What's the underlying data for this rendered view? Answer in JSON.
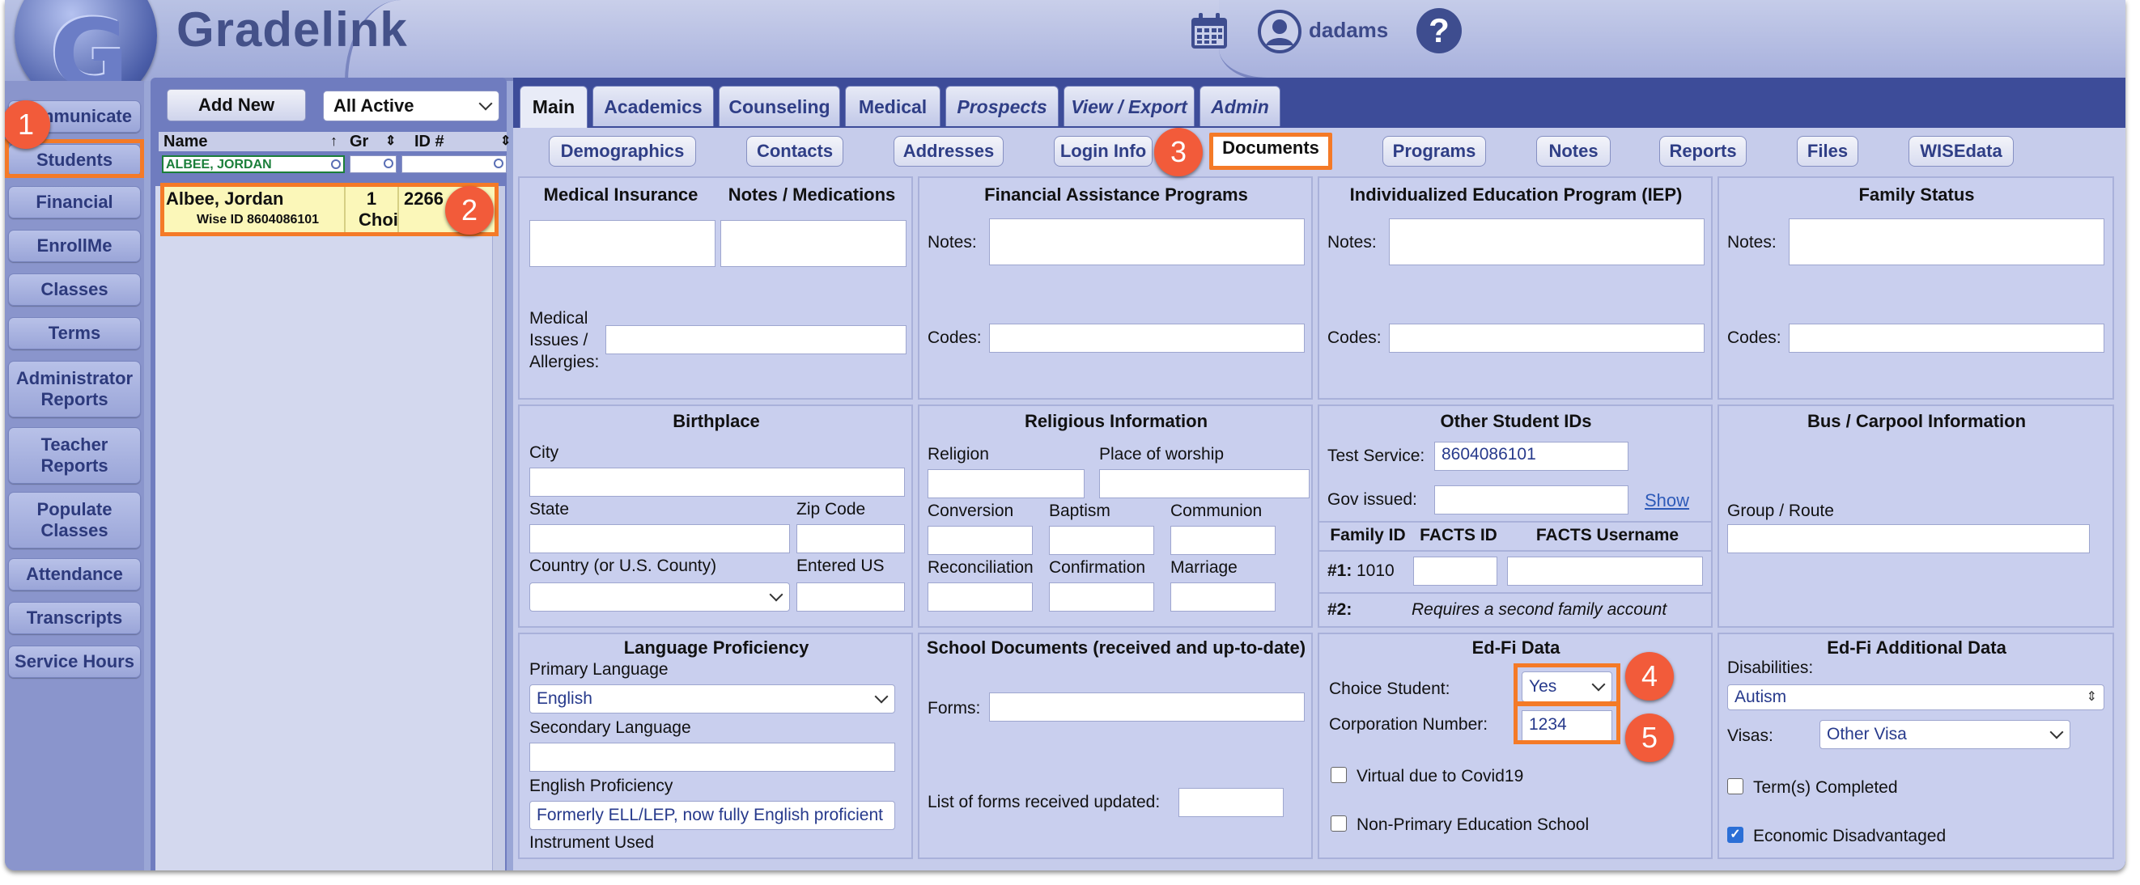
{
  "brand": {
    "name": "Gradelink",
    "logo_letter": "G"
  },
  "header": {
    "username": "dadams",
    "help_symbol": "?"
  },
  "nav": {
    "communicate": "Communicate",
    "students": "Students",
    "financial": "Financial",
    "enrollme": "EnrollMe",
    "classes": "Classes",
    "terms": "Terms",
    "admin_reports": [
      "Administrator",
      "Reports"
    ],
    "teacher_reports": [
      "Teacher",
      "Reports"
    ],
    "populate_classes": [
      "Populate",
      "Classes"
    ],
    "attendance": "Attendance",
    "transcripts": "Transcripts",
    "service_hours": "Service Hours"
  },
  "student_list": {
    "add_new": "Add New",
    "filter": "All Active",
    "columns": {
      "name": "Name",
      "grade": "Gr",
      "id": "ID #"
    },
    "name_filter": "ALBEE, JORDAN",
    "student": {
      "name": "Albee, Jordan",
      "wise_id": "Wise ID 8604086101",
      "grade": "1",
      "grade_sub": "Choic",
      "id": "2266"
    }
  },
  "tabs": [
    "Main",
    "Academics",
    "Counseling",
    "Medical",
    "Prospects",
    "View / Export",
    "Admin"
  ],
  "subtabs": [
    "Demographics",
    "Contacts",
    "Addresses",
    "Login Info",
    "Documents",
    "Programs",
    "Notes",
    "Reports",
    "Files",
    "WISEdata"
  ],
  "medical": {
    "insurance": "Medical Insurance",
    "notes_meds": "Notes / Medications",
    "issues_label": [
      "Medical",
      "Issues /",
      "Allergies:"
    ]
  },
  "financial_aid": {
    "title": "Financial Assistance Programs",
    "notes": "Notes:",
    "codes": "Codes:"
  },
  "iep": {
    "title": "Individualized Education Program (IEP)",
    "notes": "Notes:",
    "codes": "Codes:"
  },
  "family_status": {
    "title": "Family Status",
    "notes": "Notes:",
    "codes": "Codes:"
  },
  "birthplace": {
    "title": "Birthplace",
    "city": "City",
    "state": "State",
    "zip": "Zip Code",
    "country": "Country (or U.S. County)",
    "entered_us": "Entered US"
  },
  "religious": {
    "title": "Religious Information",
    "religion": "Religion",
    "worship": "Place of worship",
    "conversion": "Conversion",
    "baptism": "Baptism",
    "communion": "Communion",
    "reconciliation": "Reconciliation",
    "confirmation": "Confirmation",
    "marriage": "Marriage"
  },
  "other_ids": {
    "title": "Other Student IDs",
    "test_service_label": "Test Service:",
    "test_service_value": "8604086101",
    "gov_label": "Gov issued:",
    "show": "Show",
    "family_id": "Family ID",
    "facts_id": "FACTS ID",
    "facts_username": "FACTS Username",
    "row1_label": "#1:",
    "row1_value": "1010",
    "row2_label": "#2:",
    "row2_note": "Requires a second family account"
  },
  "bus": {
    "title": "Bus / Carpool Information",
    "group_route": "Group / Route"
  },
  "language": {
    "title": "Language Proficiency",
    "primary": "Primary Language",
    "primary_value": "English",
    "secondary": "Secondary Language",
    "english_prof": "English Proficiency",
    "english_prof_value": "Formerly ELL/LEP, now fully English proficient",
    "instrument": "Instrument Used"
  },
  "school_docs": {
    "title": "School Documents (received and up-to-date)",
    "forms": "Forms:",
    "list_updated": "List of forms received updated:"
  },
  "edfi": {
    "title": "Ed-Fi Data",
    "choice_label": "Choice Student:",
    "choice_value": "Yes",
    "corp_label": "Corporation Number:",
    "corp_value": "1234",
    "virtual": "Virtual due to Covid19",
    "non_primary": "Non-Primary Education School"
  },
  "edfi_additional": {
    "title": "Ed-Fi Additional Data",
    "disabilities": "Disabilities:",
    "disabilities_value": "Autism",
    "visas": "Visas:",
    "visas_value": "Other Visa",
    "terms_completed": "Term(s) Completed",
    "economic": "Economic Disadvantaged"
  },
  "callouts": [
    "1",
    "2",
    "3",
    "4",
    "5"
  ],
  "colors": {
    "highlight": "#f47a27",
    "badge": "#f25b3a",
    "nav_text": "#2d3a7c",
    "tab_bar": "#3d4c99"
  }
}
